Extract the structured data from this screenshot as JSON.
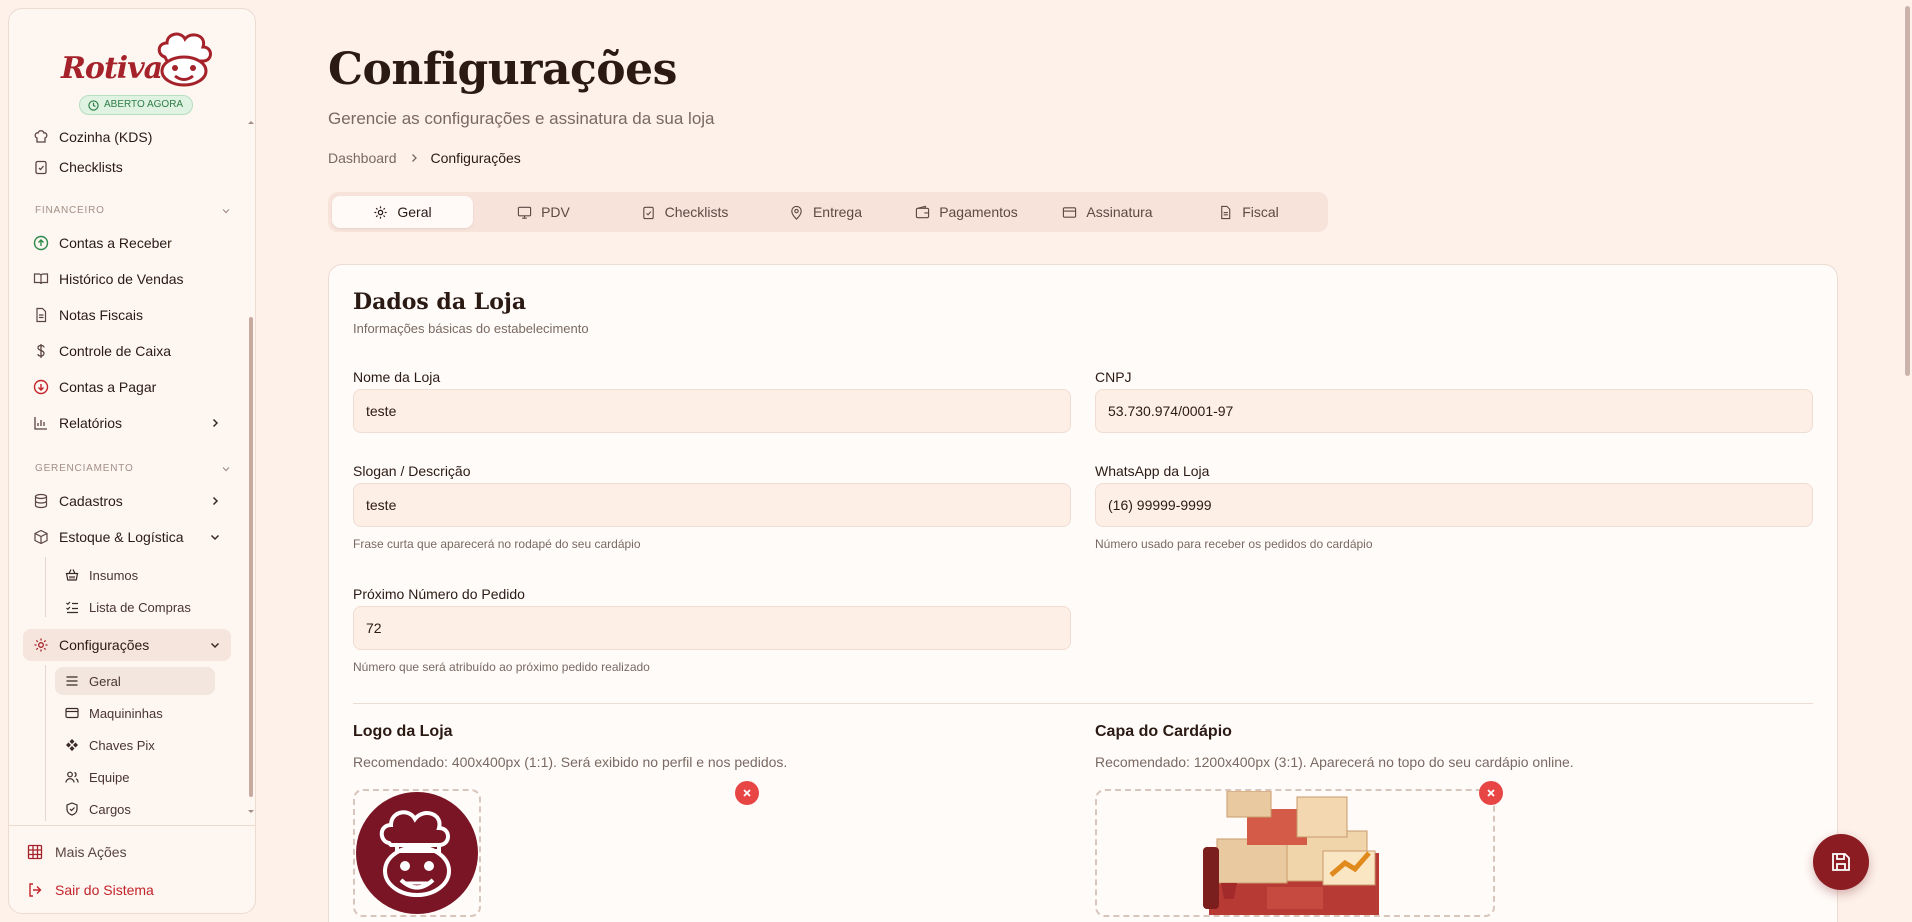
{
  "brand": {
    "name": "Rotiva",
    "status_badge": "ABERTO AGORA"
  },
  "sidebar": {
    "items_top": [
      {
        "label": "Cozinha (KDS)",
        "icon": "chef-hat-icon"
      },
      {
        "label": "Checklists",
        "icon": "clipboard-check-icon"
      }
    ],
    "section_financeiro": "FINANCEIRO",
    "financeiro": [
      {
        "label": "Contas a Receber",
        "icon": "arrow-up-circle-icon"
      },
      {
        "label": "Histórico de Vendas",
        "icon": "book-open-icon"
      },
      {
        "label": "Notas Fiscais",
        "icon": "file-text-icon"
      },
      {
        "label": "Controle de Caixa",
        "icon": "dollar-icon"
      },
      {
        "label": "Contas a Pagar",
        "icon": "arrow-down-circle-icon"
      },
      {
        "label": "Relatórios",
        "icon": "bar-chart-icon"
      }
    ],
    "section_gerenciamento": "GERENCIAMENTO",
    "gerenciamento": [
      {
        "label": "Cadastros",
        "icon": "database-icon"
      },
      {
        "label": "Estoque & Logística",
        "icon": "package-icon"
      }
    ],
    "estoque_sub": [
      {
        "label": "Insumos",
        "icon": "basket-icon"
      },
      {
        "label": "Lista de Compras",
        "icon": "list-checks-icon"
      }
    ],
    "configuracoes": {
      "label": "Configurações",
      "icon": "gear-icon"
    },
    "config_sub": [
      {
        "label": "Geral",
        "icon": "menu-icon"
      },
      {
        "label": "Maquininhas",
        "icon": "credit-card-icon"
      },
      {
        "label": "Chaves Pix",
        "icon": "pix-icon"
      },
      {
        "label": "Equipe",
        "icon": "users-icon"
      },
      {
        "label": "Cargos",
        "icon": "shield-icon"
      }
    ],
    "footer": {
      "more": "Mais Ações",
      "logout": "Sair do Sistema"
    }
  },
  "page": {
    "title": "Configurações",
    "subtitle": "Gerencie as configurações e assinatura da sua loja",
    "breadcrumb": [
      "Dashboard",
      "Configurações"
    ]
  },
  "tabs": [
    {
      "label": "Geral",
      "icon": "gear-icon",
      "active": true
    },
    {
      "label": "PDV",
      "icon": "monitor-icon"
    },
    {
      "label": "Checklists",
      "icon": "clipboard-check-icon"
    },
    {
      "label": "Entrega",
      "icon": "map-pin-icon"
    },
    {
      "label": "Pagamentos",
      "icon": "wallet-icon"
    },
    {
      "label": "Assinatura",
      "icon": "credit-card-icon"
    },
    {
      "label": "Fiscal",
      "icon": "file-text-icon"
    }
  ],
  "store": {
    "title": "Dados da Loja",
    "subtitle": "Informações básicas do estabelecimento",
    "name_label": "Nome da Loja",
    "name_value": "teste",
    "cnpj_label": "CNPJ",
    "cnpj_value": "53.730.974/0001-97",
    "slogan_label": "Slogan / Descrição",
    "slogan_value": "teste",
    "slogan_help": "Frase curta que aparecerá no rodapé do seu cardápio",
    "whatsapp_label": "WhatsApp da Loja",
    "whatsapp_value": "(16) 99999-9999",
    "whatsapp_help": "Número usado para receber os pedidos do cardápio",
    "next_order_label": "Próximo Número do Pedido",
    "next_order_value": "72",
    "next_order_help": "Número que será atribuído ao próximo pedido realizado",
    "logo_title": "Logo da Loja",
    "logo_sub": "Recomendado: 400x400px (1:1). Será exibido no perfil e nos pedidos.",
    "cover_title": "Capa do Cardápio",
    "cover_sub": "Recomendado: 1200x400px (3:1). Aparecerá no topo do seu cardápio online."
  },
  "colors": {
    "background": "#fdf1ea",
    "brand": "#a5222a",
    "logo_bg": "#7a1525",
    "danger": "#e84545",
    "fab": "#8a1c22"
  }
}
